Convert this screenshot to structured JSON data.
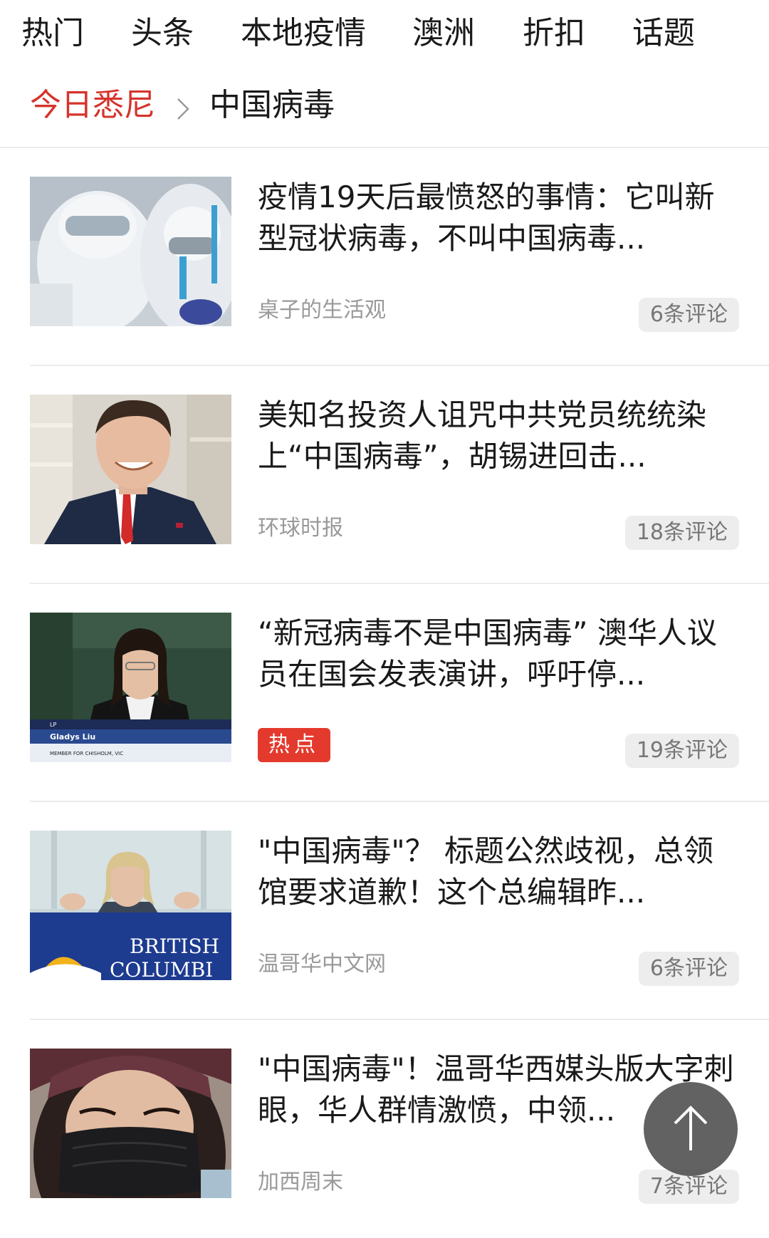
{
  "top_nav": {
    "tabs": [
      "热门",
      "头条",
      "本地疫情",
      "澳洲",
      "折扣",
      "话题"
    ]
  },
  "breadcrumb": {
    "home": "今日悉尼",
    "current": "中国病毒"
  },
  "articles": [
    {
      "title": "疫情19天后最愤怒的事情：它叫新型冠状病毒，不叫中国病毒...",
      "source": "桌子的生活观",
      "comments": "6条评论",
      "thumbnail_icon": "medical-workers-photo"
    },
    {
      "title": "美知名投资人诅咒中共党员统统染上“中国病毒”，胡锡进回击...",
      "source": "环球时报",
      "comments": "18条评论",
      "thumbnail_icon": "man-in-suit-photo"
    },
    {
      "title": "“新冠病毒不是中国病毒” 澳华人议员在国会发表演讲，呼吁停...",
      "tag": "热点",
      "comments": "19条评论",
      "thumbnail_icon": "parliament-speech-photo",
      "caption_name": "Gladys Liu",
      "caption_role": "MEMBER FOR CHISHOLM, VIC",
      "caption_party": "LP"
    },
    {
      "title": "\"中国病毒\"？ 标题公然歧视，总领馆要求道歉！这个总编辑昨...",
      "source": "温哥华中文网",
      "comments": "6条评论",
      "thumbnail_icon": "press-conference-photo",
      "podium_text_1": "BRITISH",
      "podium_text_2": "COLUMBI"
    },
    {
      "title": "\"中国病毒\"！温哥华西媒头版大字刺眼，华人群情激愤，中领...",
      "source": "加西周末",
      "comments": "7条评论",
      "thumbnail_icon": "woman-in-mask-photo"
    }
  ],
  "back_to_top_icon": "arrow-up-icon",
  "colors": {
    "accent_red": "#d6332b",
    "hot_tag": "#e43a2d",
    "muted_text": "#9a9a9a"
  }
}
